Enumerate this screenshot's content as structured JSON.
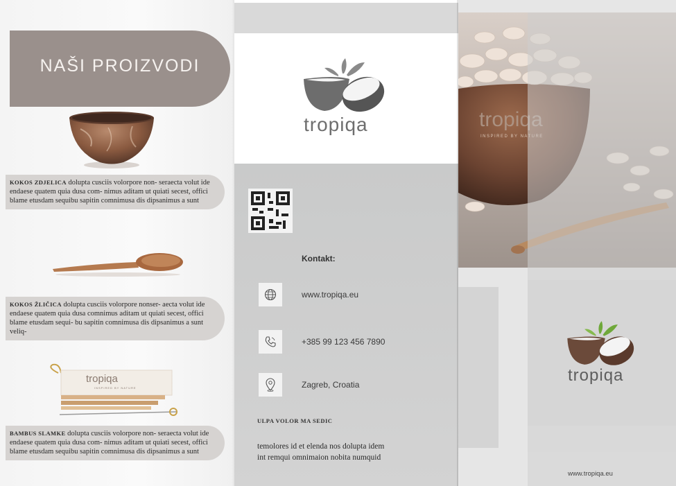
{
  "left_panel": {
    "title": "NAŠI PROIZVODI",
    "products": [
      {
        "name": "KOKOS ZDJELICA",
        "text": "dolupta cusciis volorpore non- seraecta volut ide endaese quatem quia dusa com- nimus aditam ut quiati secest, offici blame etusdam sequibu sapitin comnimusa dis dipsanimus a sunt"
      },
      {
        "name": "KOKOS ŽLIČICA",
        "text": "dolupta cusciis volorpore nonser- aecta volut ide endaese quatem quia dusa comnimus aditam ut quiati secest, offici blame etusdam sequi- bu sapitin comnimusa dis dipsanimus a sunt veliq-"
      },
      {
        "name": "BAMBUS SLAMKE",
        "text": "dolupta cusciis volorpore non- seraecta volut ide endaese quatem quia dusa com- nimus aditam ut quiati secest, offici blame etusdam sequibu sapitin comnimusa dis dipsanimus a sunt"
      }
    ],
    "straw_pack_logo": "tropiqa",
    "straw_pack_tagline": "INSPIRED BY NATURE"
  },
  "middle_panel": {
    "logo_text": "tropiqa",
    "contact_heading": "Kontakt:",
    "contacts": [
      {
        "icon": "globe-icon",
        "text": "www.tropiqa.eu"
      },
      {
        "icon": "phone-icon",
        "text": "+385 99 123 456 7890"
      },
      {
        "icon": "location-pin-icon",
        "text": "Zagreb, Croatia"
      }
    ],
    "section_heading": "ULPA VOLOR MA SEDIC",
    "section_text_line1": "temolores id et elenda nos dolupta idem",
    "section_text_line2": "int remqui omnimaion nobita numquid"
  },
  "right_panel": {
    "photo_logo": "tropiqa",
    "photo_tagline": "INSPIRED BY NATURE",
    "logo_text": "tropiqa",
    "website": "www.tropiqa.eu"
  },
  "colors": {
    "accent_taupe": "#9a908c",
    "pill_grey": "#d6d3d1",
    "panel_grey": "#cbcbcb",
    "coconut_brown": "#6b4a3a",
    "leaf_green": "#6fa83a"
  }
}
